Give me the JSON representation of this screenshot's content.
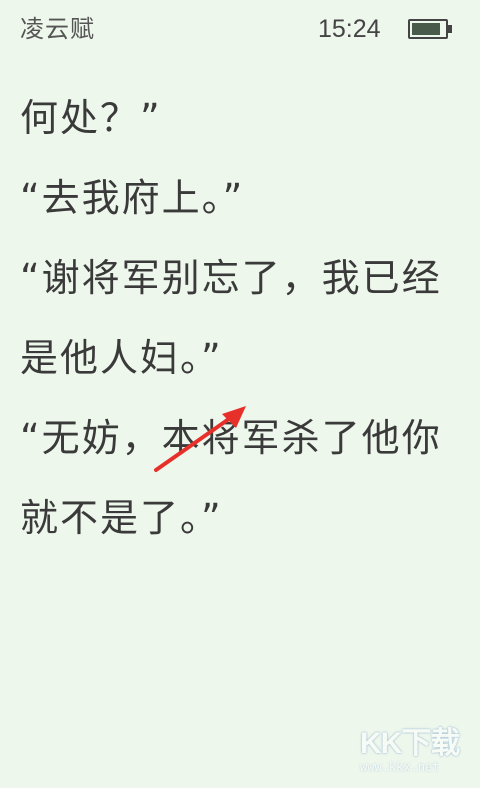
{
  "status_bar": {
    "book_title": "凌云赋",
    "time": "15:24",
    "battery_icon": "battery-icon",
    "battery_level": 0.88
  },
  "reading": {
    "lines": [
      "何处？”",
      "“去我府上。”",
      "“谢将军别忘了，我已经",
      "是他人妇。”",
      "“无妨，本将军杀了他你",
      "就不是了。”"
    ]
  },
  "annotation": {
    "icon": "red-arrow-icon",
    "color": "#e8302a"
  },
  "watermark": {
    "logo": "KK下载",
    "url": "www.kkx.net"
  }
}
